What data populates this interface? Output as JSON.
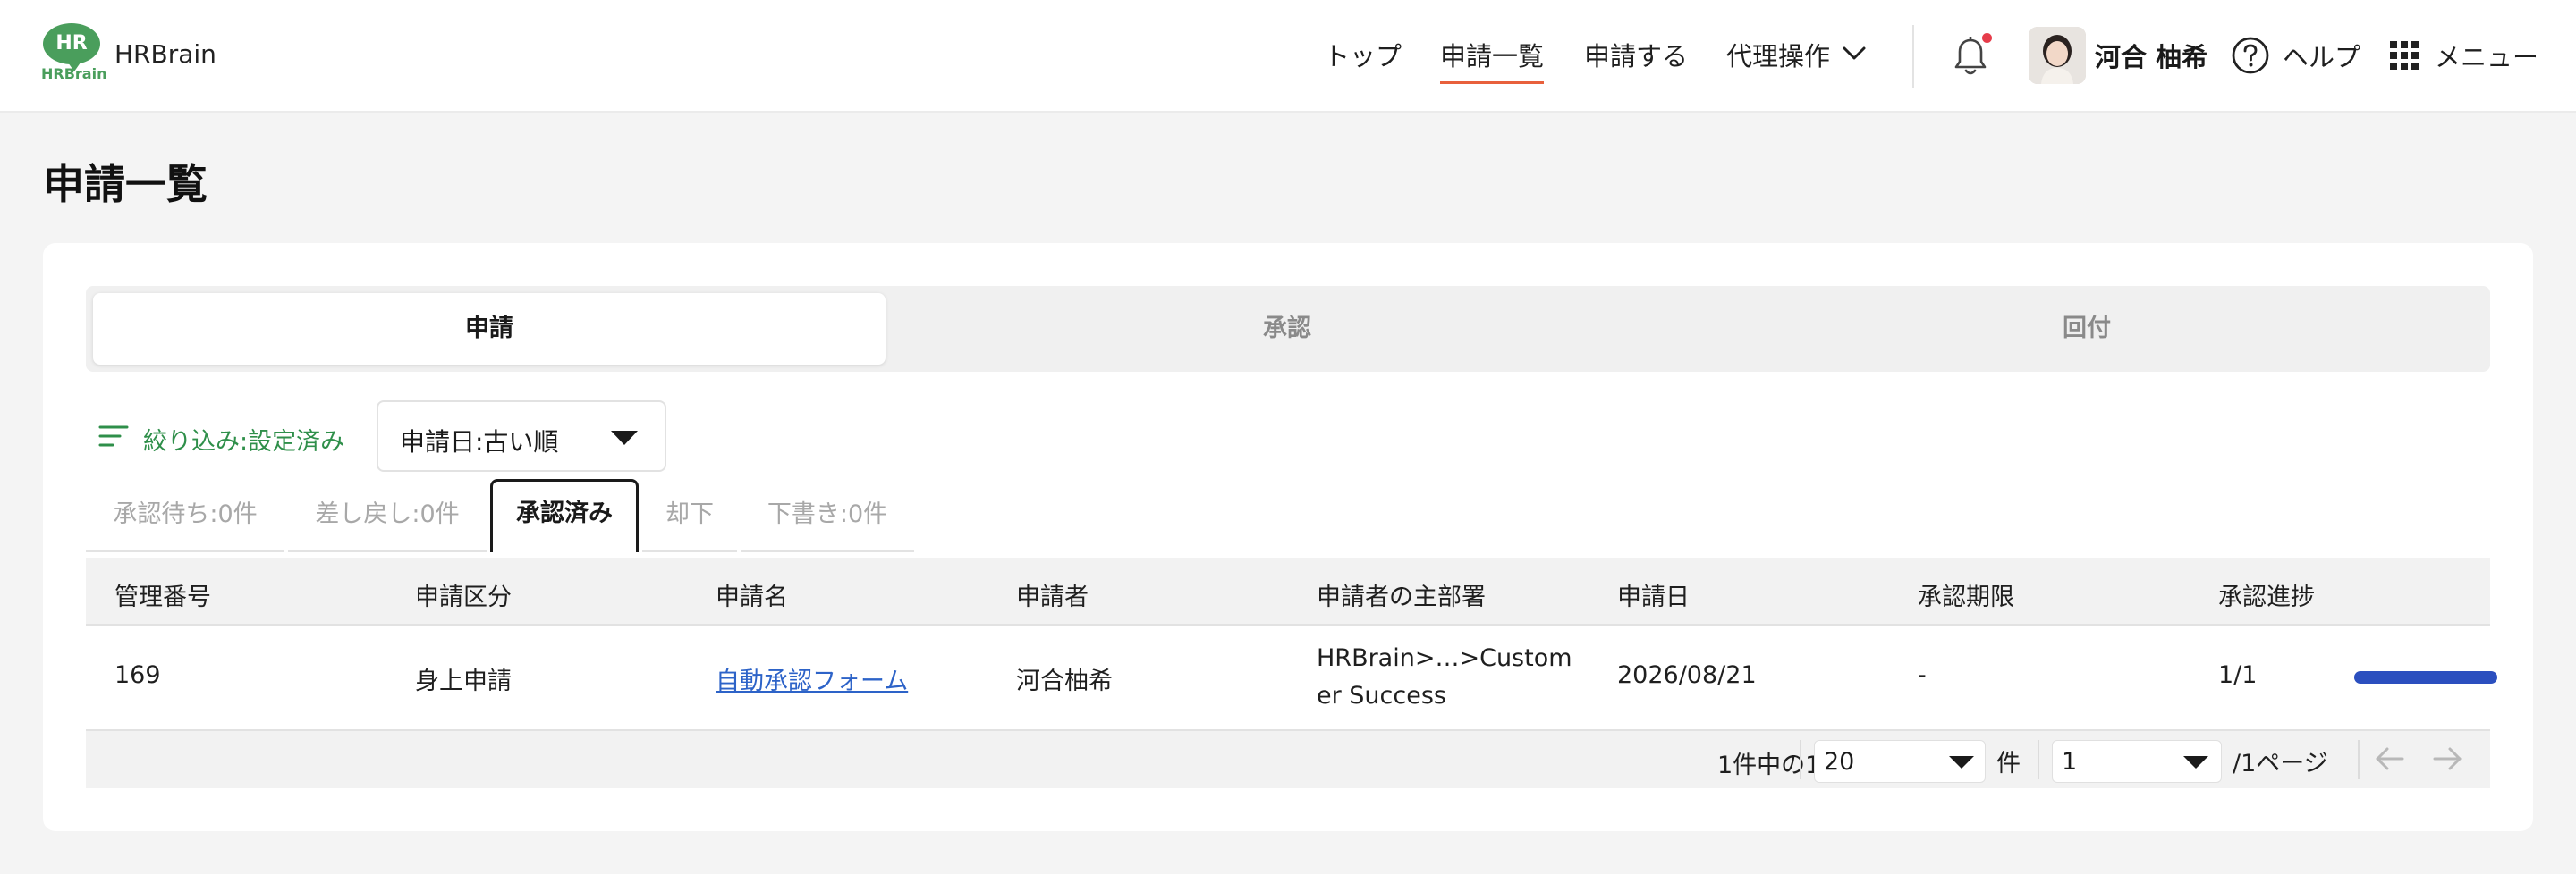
{
  "header": {
    "logo_text": "HR",
    "logo_sub": "HRBrain",
    "brand": "HRBrain",
    "nav": [
      "トップ",
      "申請一覧",
      "申請する",
      "代理操作"
    ],
    "user_name": "河合 柚希",
    "help": "ヘルプ",
    "menu": "メニュー"
  },
  "page": {
    "title": "申請一覧"
  },
  "tabs": [
    "申請",
    "承認",
    "回付"
  ],
  "filter": {
    "label": "絞り込み:設定済み",
    "sort_value": "申請日:古い順"
  },
  "status_tabs": [
    "承認待ち:0件",
    "差し戻し:0件",
    "承認済み",
    "却下",
    "下書き:0件"
  ],
  "table": {
    "columns": [
      "管理番号",
      "申請区分",
      "申請名",
      "申請者",
      "申請者の主部署",
      "申請日",
      "承認期限",
      "承認進捗"
    ],
    "rows": [
      {
        "id": "169",
        "category": "身上申請",
        "name": "自動承認フォーム",
        "applicant": "河合柚希",
        "dept_line1": "HRBrain>…>Custom",
        "dept_line2": "er Success",
        "date": "2026/08/21",
        "deadline": "-",
        "progress_text": "1/1",
        "progress_fraction": 1.0
      }
    ]
  },
  "pagination": {
    "count_text": "1件中の1-1件",
    "per_page": "20",
    "per_page_unit": "件",
    "page": "1",
    "page_suffix": "/1ページ"
  },
  "colors": {
    "accent_green": "#2f8f4a",
    "nav_underline": "#e8603c",
    "link_blue": "#2d63c8",
    "progress_blue": "#2b4fbf",
    "notification_dot": "#e63c4a"
  }
}
